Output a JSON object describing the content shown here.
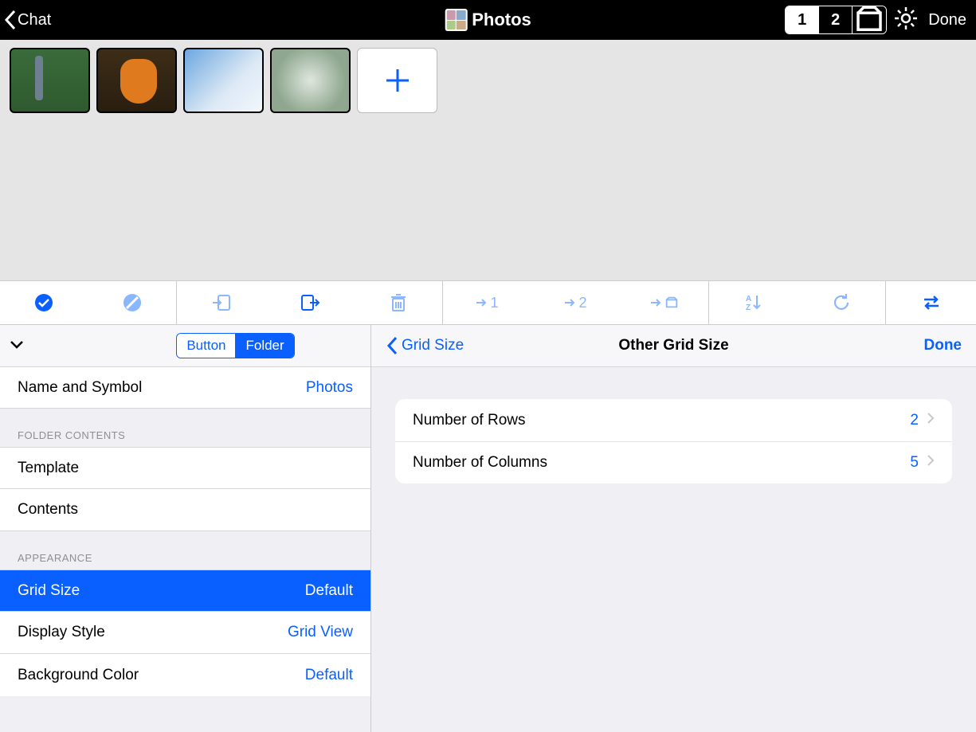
{
  "topbar": {
    "back_label": "Chat",
    "title": "Photos",
    "seg": {
      "one": "1",
      "two": "2"
    },
    "done": "Done"
  },
  "thumbs": {
    "count": 4
  },
  "toolbar": {
    "goto1": "1",
    "goto2": "2"
  },
  "left": {
    "seg": {
      "button": "Button",
      "folder": "Folder"
    },
    "name_row": {
      "label": "Name and Symbol",
      "value": "Photos"
    },
    "section_folder": "FOLDER CONTENTS",
    "template": "Template",
    "contents": "Contents",
    "section_appearance": "APPEARANCE",
    "grid_size": {
      "label": "Grid Size",
      "value": "Default"
    },
    "display_style": {
      "label": "Display Style",
      "value": "Grid View"
    },
    "bg_color": {
      "label": "Background Color",
      "value": "Default"
    }
  },
  "right": {
    "back": "Grid Size",
    "title": "Other Grid Size",
    "done": "Done",
    "rows": {
      "label": "Number of Rows",
      "value": "2"
    },
    "cols": {
      "label": "Number of Columns",
      "value": "5"
    }
  }
}
